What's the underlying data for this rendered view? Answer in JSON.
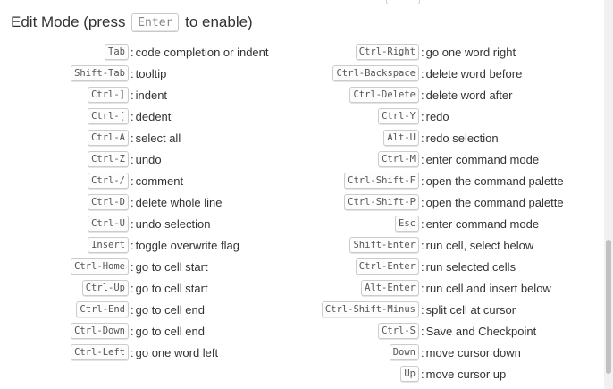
{
  "title": {
    "prefix": "Edit Mode (press",
    "key": "Enter",
    "suffix": "to enable)"
  },
  "separator": ":",
  "left_shortcuts": [
    {
      "key": "Tab",
      "desc": "code completion or indent"
    },
    {
      "key": "Shift-Tab",
      "desc": "tooltip"
    },
    {
      "key": "Ctrl-]",
      "desc": "indent"
    },
    {
      "key": "Ctrl-[",
      "desc": "dedent"
    },
    {
      "key": "Ctrl-A",
      "desc": "select all"
    },
    {
      "key": "Ctrl-Z",
      "desc": "undo"
    },
    {
      "key": "Ctrl-/",
      "desc": "comment"
    },
    {
      "key": "Ctrl-D",
      "desc": "delete whole line"
    },
    {
      "key": "Ctrl-U",
      "desc": "undo selection"
    },
    {
      "key": "Insert",
      "desc": "toggle overwrite flag"
    },
    {
      "key": "Ctrl-Home",
      "desc": "go to cell start"
    },
    {
      "key": "Ctrl-Up",
      "desc": "go to cell start"
    },
    {
      "key": "Ctrl-End",
      "desc": "go to cell end"
    },
    {
      "key": "Ctrl-Down",
      "desc": "go to cell end"
    },
    {
      "key": "Ctrl-Left",
      "desc": "go one word left"
    }
  ],
  "right_shortcuts": [
    {
      "key": "Ctrl-Right",
      "desc": "go one word right"
    },
    {
      "key": "Ctrl-Backspace",
      "desc": "delete word before"
    },
    {
      "key": "Ctrl-Delete",
      "desc": "delete word after"
    },
    {
      "key": "Ctrl-Y",
      "desc": "redo"
    },
    {
      "key": "Alt-U",
      "desc": "redo selection"
    },
    {
      "key": "Ctrl-M",
      "desc": "enter command mode"
    },
    {
      "key": "Ctrl-Shift-F",
      "desc": "open the command palette"
    },
    {
      "key": "Ctrl-Shift-P",
      "desc": "open the command palette"
    },
    {
      "key": "Esc",
      "desc": "enter command mode"
    },
    {
      "key": "Shift-Enter",
      "desc": "run cell, select below"
    },
    {
      "key": "Ctrl-Enter",
      "desc": "run selected cells"
    },
    {
      "key": "Alt-Enter",
      "desc": "run cell and insert below"
    },
    {
      "key": "Ctrl-Shift-Minus",
      "desc": "split cell at cursor"
    },
    {
      "key": "Ctrl-S",
      "desc": "Save and Checkpoint"
    },
    {
      "key": "Down",
      "desc": "move cursor down"
    },
    {
      "key": "Up",
      "desc": "move cursor up"
    }
  ]
}
